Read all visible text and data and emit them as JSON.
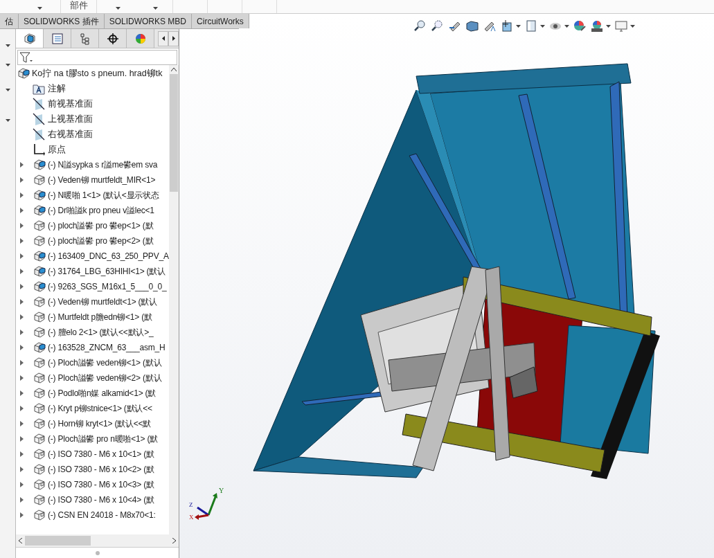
{
  "ribbon": {
    "group_label": "部件"
  },
  "tabs": [
    {
      "label": "估",
      "selected": false
    },
    {
      "label": "SOLIDWORKS 插件",
      "selected": false
    },
    {
      "label": "SOLIDWORKS MBD",
      "selected": false
    },
    {
      "label": "CircuitWorks",
      "selected": false
    }
  ],
  "tree": {
    "root": "Ko拧 na t膠sto s pneum. hrad铆tk",
    "features": [
      {
        "kind": "annotations",
        "label": "注解"
      },
      {
        "kind": "plane",
        "label": "前视基准面"
      },
      {
        "kind": "plane",
        "label": "上视基准面"
      },
      {
        "kind": "plane",
        "label": "右视基准面"
      },
      {
        "kind": "origin",
        "label": "原点"
      }
    ],
    "components": [
      {
        "kind": "assembly",
        "label": "(-) N謚sypka s r謚me鬰em sva"
      },
      {
        "kind": "part",
        "label": "(-) Veden铆 murtfeldt_MIR<1>"
      },
      {
        "kind": "assembly",
        "label": "(-) N暖啪 1<1> (默认<显示状态"
      },
      {
        "kind": "assembly",
        "label": "(-) Dr啪謚k pro pneu v謚lec<1"
      },
      {
        "kind": "part",
        "label": "(-) ploch謚鬰 pro 鬰ep<1> (默"
      },
      {
        "kind": "part",
        "label": "(-) ploch謚鬰 pro 鬰ep<2> (默"
      },
      {
        "kind": "assembly",
        "label": "(-) 163409_DNC_63_250_PPV_A"
      },
      {
        "kind": "assembly",
        "label": "(-) 31764_LBG_63HIHI<1> (默认"
      },
      {
        "kind": "assembly",
        "label": "(-) 9263_SGS_M16x1_5___0_0_"
      },
      {
        "kind": "part",
        "label": "(-) Veden铆 murtfeldt<1> (默认"
      },
      {
        "kind": "part",
        "label": "(-) Murtfeldt p膽edn铆<1> (默"
      },
      {
        "kind": "part",
        "label": "(-) 膻elo 2<1> (默认<<默认>_"
      },
      {
        "kind": "assembly",
        "label": "(-) 163528_ZNCM_63___asm_H"
      },
      {
        "kind": "part",
        "label": "(-) Ploch謚鬰 veden铆<1> (默认"
      },
      {
        "kind": "part",
        "label": "(-) Ploch謚鬰 veden铆<2> (默认"
      },
      {
        "kind": "part",
        "label": "(-) Podlo啪n媒 alkamid<1> (默"
      },
      {
        "kind": "part",
        "label": "(-) Kryt p铆stnice<1> (默认<<"
      },
      {
        "kind": "part",
        "label": "(-) Horn铆 kryt<1> (默认<<默"
      },
      {
        "kind": "part",
        "label": "(-) Ploch謚鬰 pro n暖啪<1> (默"
      },
      {
        "kind": "part",
        "label": "(-) ISO 7380 - M6 x 10<1> (默"
      },
      {
        "kind": "part",
        "label": "(-) ISO 7380 - M6 x 10<2> (默"
      },
      {
        "kind": "part",
        "label": "(-) ISO 7380 - M6 x 10<3> (默"
      },
      {
        "kind": "part",
        "label": "(-) ISO 7380 - M6 x 10<4> (默"
      },
      {
        "kind": "part",
        "label": "(-) CSN EN 24018 - M8x70<1:"
      }
    ]
  },
  "triad": {
    "x": "X",
    "y": "Y",
    "z": "Z"
  }
}
